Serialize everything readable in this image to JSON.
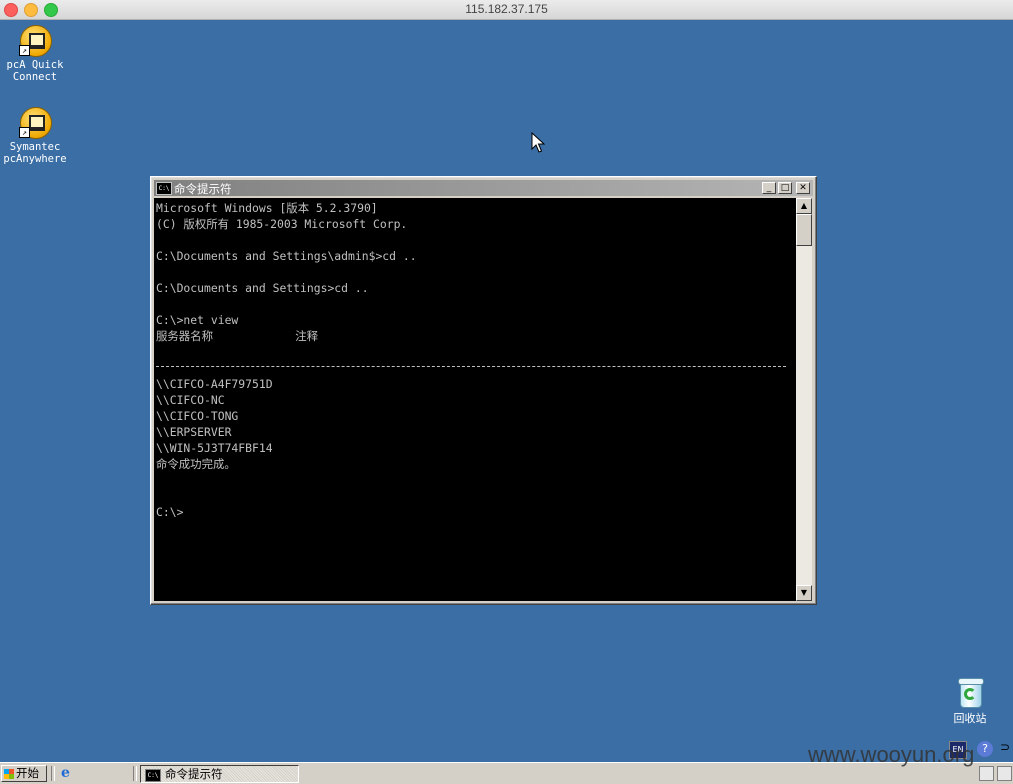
{
  "mac_window": {
    "title": "115.182.37.175"
  },
  "desktop": {
    "icons": [
      {
        "label_line1": "pcA Quick",
        "label_line2": "Connect"
      },
      {
        "label_line1": "Symantec",
        "label_line2": "pcAnywhere"
      }
    ],
    "recycle_bin": {
      "label": "回收站"
    }
  },
  "cmd_window": {
    "title": "命令提示符",
    "buttons": {
      "minimize": "_",
      "maximize": "□",
      "close": "✕"
    },
    "icon_text": "C:\\",
    "lines_top": [
      "Microsoft Windows [版本 5.2.3790]",
      "(C) 版权所有 1985-2003 Microsoft Corp.",
      "",
      "C:\\Documents and Settings\\admin$>cd ..",
      "",
      "C:\\Documents and Settings>cd ..",
      "",
      "C:\\>net view",
      "服务器名称            注释"
    ],
    "lines_bottom": [
      "\\\\CIFCO-A4F79751D",
      "\\\\CIFCO-NC",
      "\\\\CIFCO-TONG",
      "\\\\ERPSERVER",
      "\\\\WIN-5J3T74FBF14",
      "命令成功完成。",
      "",
      "",
      "C:\\>"
    ]
  },
  "taskbar": {
    "start_label": "开始",
    "task_button_label": "命令提示符",
    "tray_lang": "EN",
    "tray_help": "?",
    "tray_more": "⊃"
  },
  "watermark": "www.wooyun.org",
  "colors": {
    "desktop_bg": "#3a6ea5",
    "console_bg": "#000000",
    "console_fg": "#c0c0c0",
    "titlebar_inactive": "#808080"
  }
}
